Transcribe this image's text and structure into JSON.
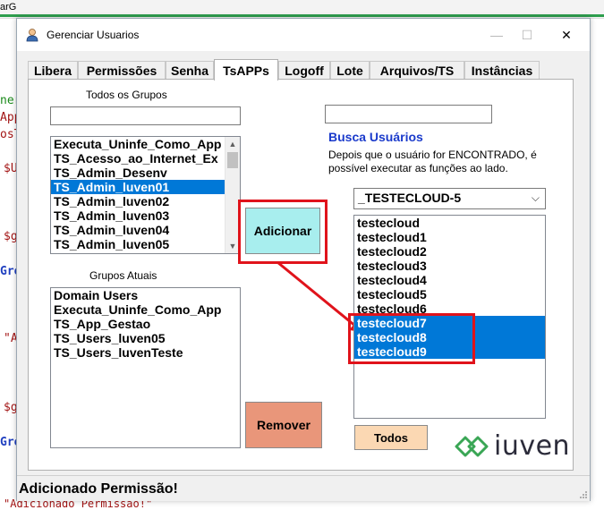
{
  "background": {
    "top_tab_fragment": "arG",
    "code_lines": [
      {
        "text": "ner",
        "color": "#1b8a1b"
      },
      {
        "text": "App",
        "color": "#a31515"
      },
      {
        "text": "osT",
        "color": "#a31515"
      },
      {
        "text": "$U",
        "color": "#a31515"
      },
      {
        "text": "$g",
        "color": "#a31515"
      },
      {
        "text": "Gro",
        "color": "#1f3fbf"
      },
      {
        "text": "\"A",
        "color": "#a31515"
      },
      {
        "text": "$g",
        "color": "#a31515"
      },
      {
        "text": "Gro",
        "color": "#1f3fbf"
      }
    ],
    "bottom_fragment": "\"Adicionado Permissão!\""
  },
  "window": {
    "title": "Gerenciar Usuarios",
    "minimize_glyph": "—",
    "maximize_glyph": "☐",
    "close_glyph": "✕"
  },
  "tabs": [
    {
      "label": "Libera"
    },
    {
      "label": "Permissões"
    },
    {
      "label": "Senha"
    },
    {
      "label": "TsAPPs",
      "active": true
    },
    {
      "label": "Logoff"
    },
    {
      "label": "Lote"
    },
    {
      "label": "Arquivos/TS"
    },
    {
      "label": "Instâncias"
    }
  ],
  "groups_panel": {
    "all_groups_label": "Todos os Grupos",
    "all_groups_filter_value": "",
    "all_groups": [
      "Executa_Uninfe_Como_App",
      "TS_Acesso_ao_Internet_Ex",
      "TS_Admin_Desenv",
      "TS_Admin_luven01",
      "TS_Admin_luven02",
      "TS_Admin_luven03",
      "TS_Admin_luven04",
      "TS_Admin_luven05"
    ],
    "all_groups_selected_index": 3,
    "current_groups_label": "Grupos Atuais",
    "current_groups": [
      "Domain Users",
      "Executa_Uninfe_Como_App",
      "TS_App_Gestao",
      "TS_Users_luven05",
      "TS_Users_luvenTeste"
    ]
  },
  "actions": {
    "add_label": "Adicionar",
    "add_color": "#a8eeee",
    "remove_label": "Remover",
    "remove_color": "#e9967a",
    "all_label": "Todos",
    "all_color": "#fbd8b3",
    "highlight_color": "#e0131b"
  },
  "users_panel": {
    "search_value": "",
    "search_title": "Busca Usuários",
    "search_title_color": "#1a3acb",
    "help_text_line1": "Depois que o usuário for ENCONTRADO, é",
    "help_text_line2": "possível executar as funções ao lado.",
    "selected_user": "_TESTECLOUD-5",
    "users": [
      "testecloud",
      "testecloud1",
      "testecloud2",
      "testecloud3",
      "testecloud4",
      "testecloud5",
      "testecloud6",
      "testecloud7",
      "testecloud8",
      "testecloud9"
    ],
    "selected_users": [
      "testecloud7",
      "testecloud8",
      "testecloud9"
    ]
  },
  "logo": {
    "text": "iuven",
    "color": "#3aa655"
  },
  "status": {
    "message": "Adicionado Permissão!"
  }
}
